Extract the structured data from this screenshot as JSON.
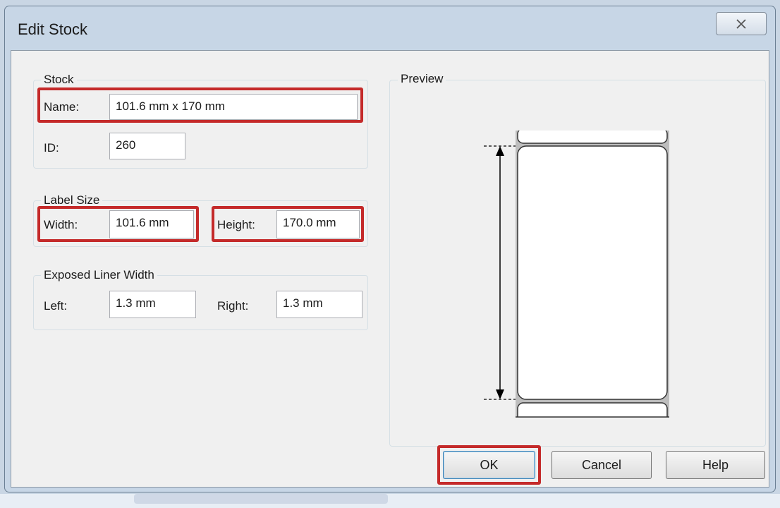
{
  "dialog": {
    "title": "Edit Stock",
    "close_icon": "close-icon"
  },
  "stock": {
    "group_label": "Stock",
    "name_label": "Name:",
    "name_value": "101.6 mm x 170 mm",
    "id_label": "ID:",
    "id_value": "260"
  },
  "label_size": {
    "group_label": "Label Size",
    "width_label": "Width:",
    "width_value": "101.6 mm",
    "height_label": "Height:",
    "height_value": "170.0 mm"
  },
  "exposed_liner": {
    "group_label": "Exposed Liner Width",
    "left_label": "Left:",
    "left_value": "1.3 mm",
    "right_label": "Right:",
    "right_value": "1.3 mm"
  },
  "preview": {
    "group_label": "Preview"
  },
  "buttons": {
    "ok": "OK",
    "cancel": "Cancel",
    "help": "Help"
  },
  "colors": {
    "highlight": "#c42a2a",
    "dialog_background": "#f0f0f0",
    "title_bar": "#c7d6e6"
  }
}
